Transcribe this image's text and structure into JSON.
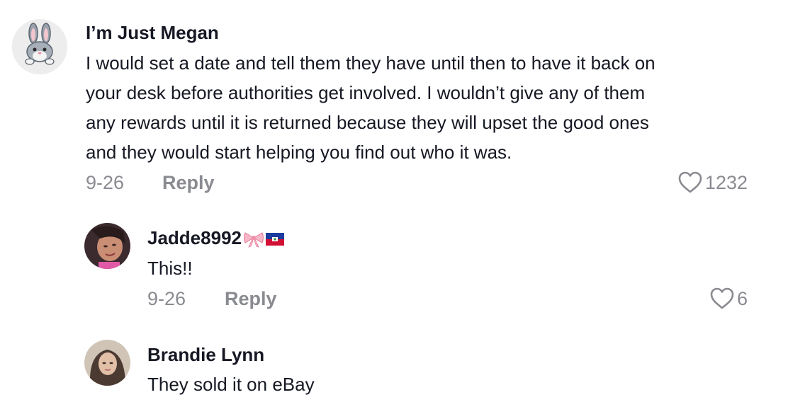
{
  "comments": [
    {
      "username": "I’m Just Megan",
      "text_lines": [
        "I would set a date and tell them they have until then to have it back on",
        "your desk before authorities get involved. I wouldn’t give any of them",
        "any rewards until it is returned because they will upset the good ones",
        "and they would start helping you find out who it was."
      ],
      "date": "9-26",
      "reply_label": "Reply",
      "likes": "1232",
      "avatar_icon": "bunny-avatar-icon"
    }
  ],
  "replies": [
    {
      "username": "Jadde8992",
      "emojis": [
        "ribbon-bow-icon",
        "haiti-flag-icon"
      ],
      "text": "This!!",
      "date": "9-26",
      "reply_label": "Reply",
      "likes": "6"
    },
    {
      "username": "Brandie Lynn",
      "text": "They sold it on eBay"
    }
  ],
  "colors": {
    "text_primary": "#161823",
    "text_secondary": "#8a8b91",
    "background": "#ffffff"
  }
}
